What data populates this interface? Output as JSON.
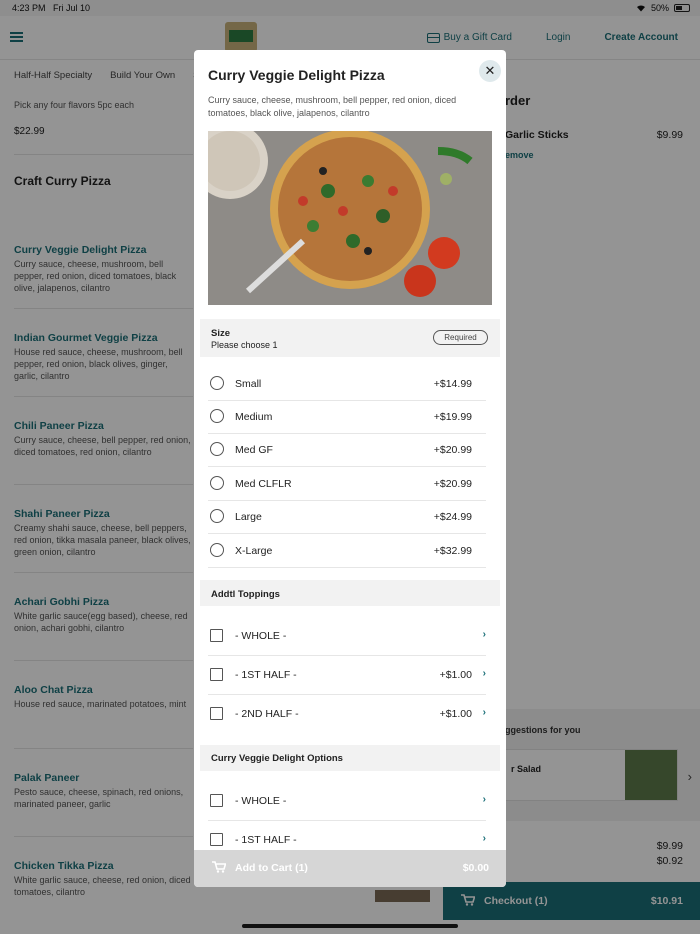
{
  "status": {
    "time": "4:23 PM",
    "date": "Fri Jul 10",
    "battery": "50%"
  },
  "nav": {
    "gift_label": "Buy a Gift Card",
    "login_label": "Login",
    "create_label": "Create Account"
  },
  "category_tabs": [
    "Half-Half Specialty",
    "Build Your Own",
    "S"
  ],
  "menu": {
    "pickany": "Pick any four flavors 5pc each",
    "pickany_price": "$22.99",
    "section_title": "Craft Curry Pizza",
    "items": [
      {
        "name": "Curry Veggie Delight Pizza",
        "desc": "Curry sauce, cheese, mushroom, bell pepper, red onion, diced tomatoes, black olive, jalapenos, cilantro"
      },
      {
        "name": "Indian Gourmet Veggie Pizza",
        "desc": "House red sauce, cheese, mushroom, bell pepper, red onion, black olives, ginger, garlic, cilantro"
      },
      {
        "name": "Chili Paneer Pizza",
        "desc": "Curry sauce, cheese, bell pepper, red onion, diced tomatoes, red onion, cilantro"
      },
      {
        "name": "Shahi Paneer Pizza",
        "desc": "Creamy shahi sauce, cheese, bell peppers, red onion, tikka masala paneer, black olives, green onion, cilantro"
      },
      {
        "name": "Achari Gobhi Pizza",
        "desc": "White garlic sauce(egg based), cheese, red onion, achari gobhi, cilantro"
      },
      {
        "name": "Aloo Chat Pizza",
        "desc": "House red sauce, marinated potatoes, mint"
      },
      {
        "name": "Palak Paneer",
        "desc": "Pesto sauce, cheese, spinach, red onions, marinated paneer, garlic"
      },
      {
        "name": "Chicken Tikka Pizza",
        "desc": "White garlic sauce, cheese, red onion, diced tomatoes, cilantro"
      }
    ]
  },
  "order": {
    "title": "rder",
    "item_name": "Garlic Sticks",
    "item_price": "$9.99",
    "remove_label": "emove"
  },
  "suggestions": {
    "label": "ggestions for you",
    "card_name": "r Salad"
  },
  "totals": {
    "subtotal": "$9.99",
    "tax": "$0.92"
  },
  "checkout": {
    "label": "Checkout (1)",
    "total": "$10.91"
  },
  "modal": {
    "title": "Curry Veggie Delight Pizza",
    "close_label": "✕",
    "description": "Curry sauce, cheese, mushroom, bell pepper, red onion, diced tomatoes, black olive, jalapenos, cilantro",
    "size_group": {
      "title": "Size",
      "subtitle": "Please choose 1",
      "badge": "Required",
      "options": [
        {
          "label": "Small",
          "price": "+$14.99"
        },
        {
          "label": "Medium",
          "price": "+$19.99"
        },
        {
          "label": "Med GF",
          "price": "+$20.99"
        },
        {
          "label": "Med CLFLR",
          "price": "+$20.99"
        },
        {
          "label": "Large",
          "price": "+$24.99"
        },
        {
          "label": "X-Large",
          "price": "+$32.99"
        }
      ]
    },
    "toppings_group": {
      "title": "Addtl Toppings",
      "options": [
        {
          "label": "- WHOLE -",
          "price": ""
        },
        {
          "label": "- 1ST HALF -",
          "price": "+$1.00"
        },
        {
          "label": "- 2ND HALF -",
          "price": "+$1.00"
        }
      ]
    },
    "options_group": {
      "title": "Curry Veggie Delight Options",
      "options": [
        {
          "label": "- WHOLE -",
          "price": ""
        },
        {
          "label": "- 1ST HALF -",
          "price": ""
        }
      ]
    },
    "add_to_cart": {
      "label": "Add to Cart (1)",
      "price": "$0.00"
    }
  },
  "colors": {
    "accent": "#1b6f78",
    "overlay": "rgba(0,0,0,0.42)"
  }
}
